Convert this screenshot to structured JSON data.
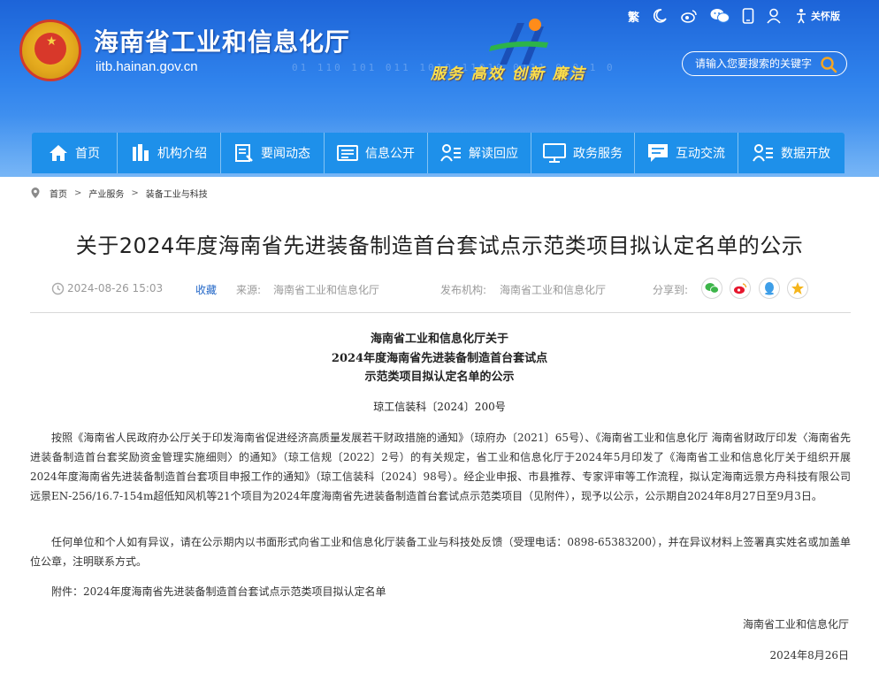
{
  "header": {
    "site_title": "海南省工业和信息化厅",
    "site_domain": "iitb.hainan.gov.cn",
    "slogan": "服务  高效  创新  廉洁",
    "binary_text": "01 110 101 011 1010 11010 0111 0 0 1 0",
    "tools": {
      "traditional": "繁",
      "care_version": "关怀版"
    },
    "search": {
      "placeholder": "请输入您要搜索的关键字"
    }
  },
  "nav": {
    "items": [
      {
        "label": "首页",
        "icon": "home-icon"
      },
      {
        "label": "机构介绍",
        "icon": "building-icon"
      },
      {
        "label": "要闻动态",
        "icon": "news-icon"
      },
      {
        "label": "信息公开",
        "icon": "info-icon"
      },
      {
        "label": "解读回应",
        "icon": "interpret-icon"
      },
      {
        "label": "政务服务",
        "icon": "monitor-icon"
      },
      {
        "label": "互动交流",
        "icon": "chat-icon"
      },
      {
        "label": "数据开放",
        "icon": "data-icon"
      }
    ]
  },
  "breadcrumb": {
    "items": [
      "首页",
      "产业服务",
      "装备工业与科技"
    ]
  },
  "article": {
    "title": "关于2024年度海南省先进装备制造首台套试点示范类项目拟认定名单的公示",
    "meta": {
      "date": "2024-08-26 15:03",
      "favorite": "收藏",
      "source_label": "来源:",
      "source": "海南省工业和信息化厅",
      "publisher_label": "发布机构:",
      "publisher": "海南省工业和信息化厅",
      "share_label": "分享到:"
    },
    "heading_lines": [
      "海南省工业和信息化厅关于",
      "2024年度海南省先进装备制造首台套试点",
      "示范类项目拟认定名单的公示"
    ],
    "doc_number": "琼工信装科〔2024〕200号",
    "paragraphs": [
      "按照《海南省人民政府办公厅关于印发海南省促进经济高质量发展若干财政措施的通知》（琼府办〔2021〕65号）、《海南省工业和信息化厅 海南省财政厅印发〈海南省先进装备制造首台套奖励资金管理实施细则〉的通知》（琼工信规〔2022〕2号）的有关规定，省工业和信息化厅于2024年5月印发了《海南省工业和信息化厅关于组织开展2024年度海南省先进装备制造首台套项目申报工作的通知》（琼工信装科〔2024〕98号）。经企业申报、市县推荐、专家评审等工作流程，拟认定海南远景方舟科技有限公司远景EN-256/16.7-154m超低知风机等21个项目为2024年度海南省先进装备制造首台套试点示范类项目（见附件），现予以公示，公示期自2024年8月27日至9月3日。",
      "任何单位和个人如有异议，请在公示期内以书面形式向省工业和信息化厅装备工业与科技处反馈（受理电话：0898-65383200），并在异议材料上签署真实姓名或加盖单位公章，注明联系方式。",
      "附件：2024年度海南省先进装备制造首台套试点示范类项目拟认定名单"
    ],
    "signature": "海南省工业和信息化厅",
    "sign_date": "2024年8月26日"
  },
  "colors": {
    "header_blue": "#2f82ec",
    "nav_blue": "#1e90ea",
    "slogan_yellow": "#ffe14a",
    "link_blue": "#2468c8",
    "search_icon": "#f5a623"
  }
}
